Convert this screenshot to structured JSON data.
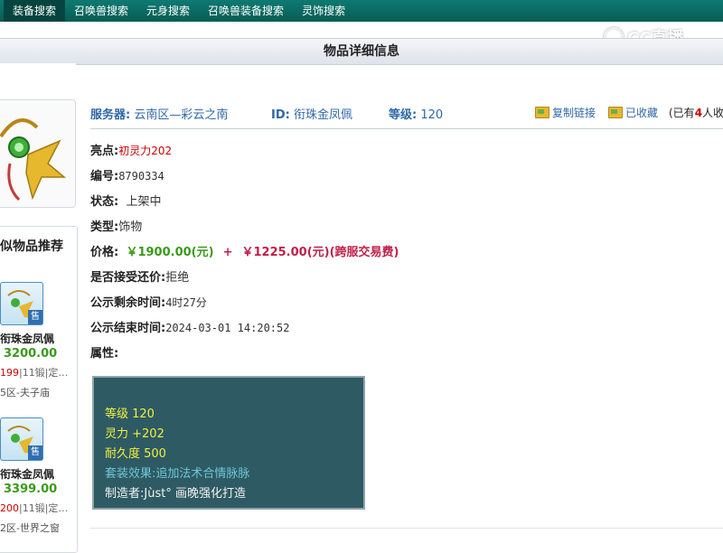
{
  "nav": {
    "tabs": [
      "装备搜索",
      "召唤兽搜索",
      "元身搜索",
      "召唤兽装备搜索",
      "灵饰搜索"
    ]
  },
  "watermark": "CC直播",
  "header": {
    "title": "物品详细信息"
  },
  "info": {
    "server_label": "服务器:",
    "server_value": "云南区—彩云之南",
    "id_label": "ID:",
    "id_value": "衔珠金凤佩",
    "level_label": "等级:",
    "level_value": "120",
    "copy_link": "复制链接",
    "favorited": "已收藏",
    "fav_count_prefix": "(已有",
    "fav_count": "4",
    "fav_count_suffix": "人收"
  },
  "details": {
    "highlight_k": "亮点:",
    "highlight_v": "初灵力202",
    "number_k": "编号:",
    "number_v": "8790334",
    "status_k": "状态:",
    "status_v": "上架中",
    "type_k": "类型:",
    "type_v": "饰物",
    "price_k": "价格:",
    "price_a": "￥1900.00(元)",
    "price_plus": "+",
    "price_b": "￥1225.00(元)(跨服交易费)",
    "bargain_k": "是否接受还价:",
    "bargain_v": "拒绝",
    "remaining_k": "公示剩余时间:",
    "remaining_v": "4时27分",
    "end_k": "公示结束时间:",
    "end_v": "2024-03-01 14:20:52",
    "attr_k": "属性:"
  },
  "attributes": {
    "level": "等级 120",
    "spirit": "灵力 +202",
    "durability": "耐久度 500",
    "set_effect": "套装效果:追加法术合情脉脉",
    "maker": "制造者:Jùst° 画晚强化打造"
  },
  "recommend": {
    "title": "似物品推荐",
    "badge": "售",
    "items": [
      {
        "name": "衔珠金凤佩",
        "price": "3200.00",
        "meta_a": "199",
        "meta_b": "|11锻|定…",
        "area": "5区-夫子庙"
      },
      {
        "name": "衔珠金凤佩",
        "price": "3399.00",
        "meta_a": "200",
        "meta_b": "|11锻|定…",
        "area": "2区-世界之窗"
      }
    ]
  }
}
